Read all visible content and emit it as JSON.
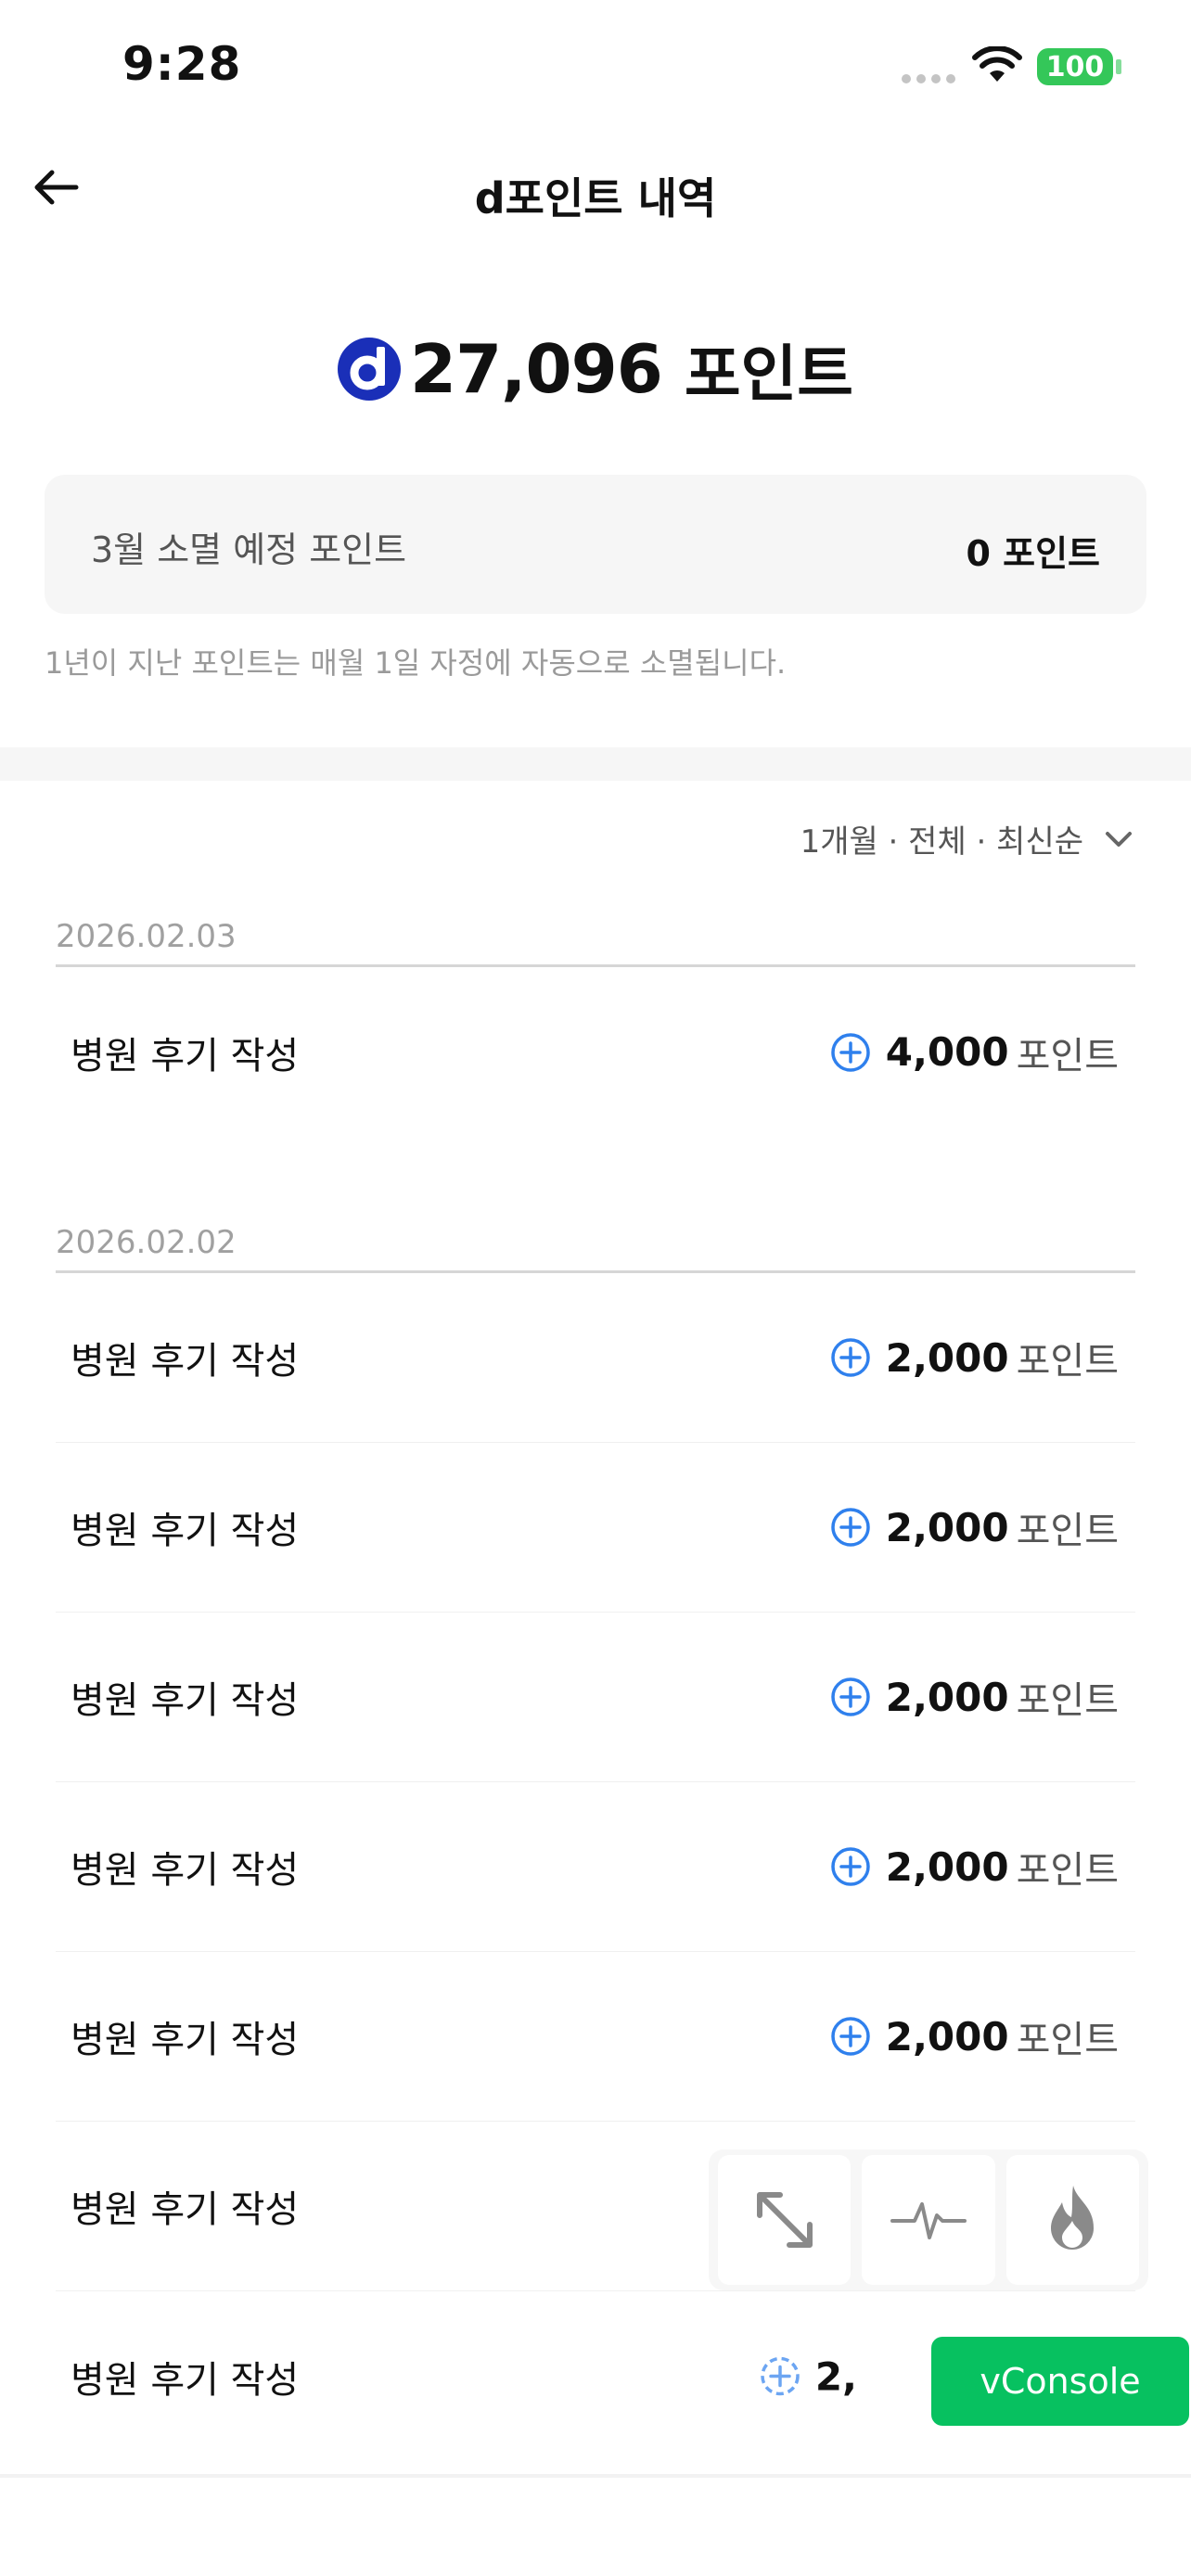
{
  "status_bar": {
    "time": "9:28",
    "battery": "100"
  },
  "nav": {
    "title": "d포인트 내역"
  },
  "balance": {
    "value": "27,096",
    "unit": "포인트"
  },
  "expiry": {
    "label": "3월 소멸 예정 포인트",
    "value": "0 포인트",
    "note": "1년이 지난 포인트는 매월 1일 자정에 자동으로 소멸됩니다."
  },
  "filter": {
    "label": "1개월 · 전체 · 최신순"
  },
  "groups": [
    {
      "date": "2026.02.03",
      "items": [
        {
          "title": "병원 후기 작성",
          "amount": "4,000",
          "unit": "포인트"
        }
      ]
    },
    {
      "date": "2026.02.02",
      "items": [
        {
          "title": "병원 후기 작성",
          "amount": "2,000",
          "unit": "포인트"
        },
        {
          "title": "병원 후기 작성",
          "amount": "2,000",
          "unit": "포인트"
        },
        {
          "title": "병원 후기 작성",
          "amount": "2,000",
          "unit": "포인트"
        },
        {
          "title": "병원 후기 작성",
          "amount": "2,000",
          "unit": "포인트"
        },
        {
          "title": "병원 후기 작성",
          "amount": "2,000",
          "unit": "포인트"
        },
        {
          "title": "병원 후기 작성",
          "amount": "",
          "unit": ""
        },
        {
          "title": "병원 후기 작성",
          "amount": "2,",
          "unit": ""
        }
      ]
    }
  ],
  "overlay": {
    "vconsole_label": "vConsole"
  },
  "colors": {
    "brand_blue": "#1a2fb8",
    "plus_blue": "#2f80ed",
    "vconsole_green": "#07c160"
  },
  "icons": {
    "back": "arrow-left-icon",
    "filter": "chevron-down-icon",
    "plus": "plus-circle-icon",
    "expand": "expand-icon",
    "pulse": "pulse-icon",
    "flame": "flame-icon"
  }
}
